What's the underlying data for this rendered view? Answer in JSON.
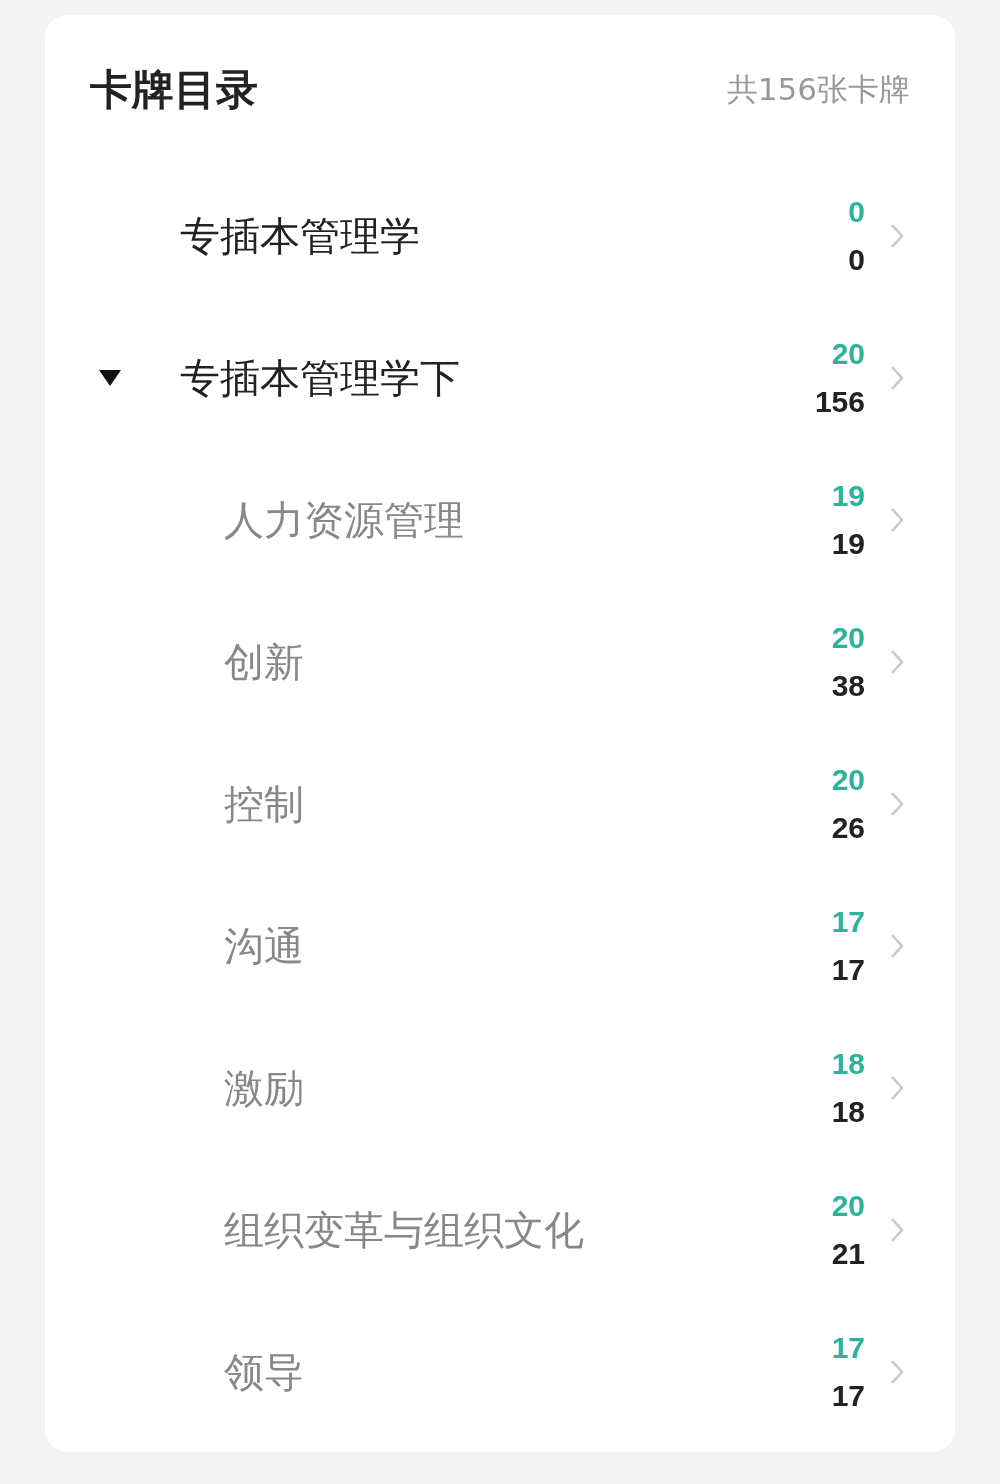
{
  "header": {
    "title": "卡牌目录",
    "total": "共156张卡牌"
  },
  "decks": [
    {
      "name": "专插本管理学",
      "due": "0",
      "count": "0"
    },
    {
      "name": "专插本管理学下",
      "due": "20",
      "count": "156",
      "expanded": true,
      "children": [
        {
          "name": "人力资源管理",
          "due": "19",
          "count": "19"
        },
        {
          "name": "创新",
          "due": "20",
          "count": "38"
        },
        {
          "name": "控制",
          "due": "20",
          "count": "26"
        },
        {
          "name": "沟通",
          "due": "17",
          "count": "17"
        },
        {
          "name": "激励",
          "due": "18",
          "count": "18"
        },
        {
          "name": "组织变革与组织文化",
          "due": "20",
          "count": "21"
        },
        {
          "name": "领导",
          "due": "17",
          "count": "17"
        }
      ]
    }
  ]
}
